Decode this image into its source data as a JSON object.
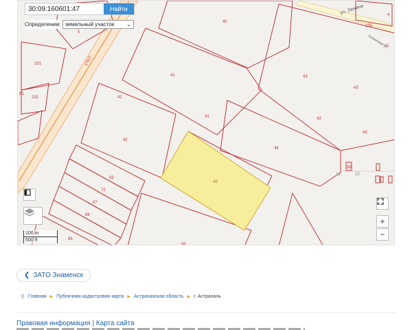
{
  "search": {
    "value": "30:09:160601:47",
    "button": "Найти"
  },
  "definition": {
    "label": "Определение:",
    "selected": "земельный участок"
  },
  "map": {
    "streets": {
      "lenina": "ул. Ленина",
      "solnech": "Солнечная ул.",
      "road": "176/7"
    },
    "parcel_labels": [
      "40",
      "41",
      "41",
      "42",
      "42",
      "43",
      "43",
      "43",
      "43",
      "44",
      "45",
      "5",
      "231",
      "232",
      "85",
      "69",
      "72",
      "87",
      "88",
      "85",
      "96",
      "155",
      "88",
      "18",
      "13",
      "4",
      "#1"
    ],
    "highlight_color": "#f6ee9a",
    "parcel_color": "#c0393b",
    "scale": {
      "metric": "100 m",
      "imperial": "500 ft"
    },
    "zoom": {
      "in": "+",
      "out": "−"
    }
  },
  "nav": {
    "back_label": "ЗАТО Знаменск",
    "breadcrumbs": [
      "Главная",
      "Публичная кадастровая карта",
      "Астраханская область",
      "г. Астрахань"
    ]
  },
  "footer": {
    "legal": "Правовая информация",
    "sep": "|",
    "sitemap": "Карта сайта"
  }
}
